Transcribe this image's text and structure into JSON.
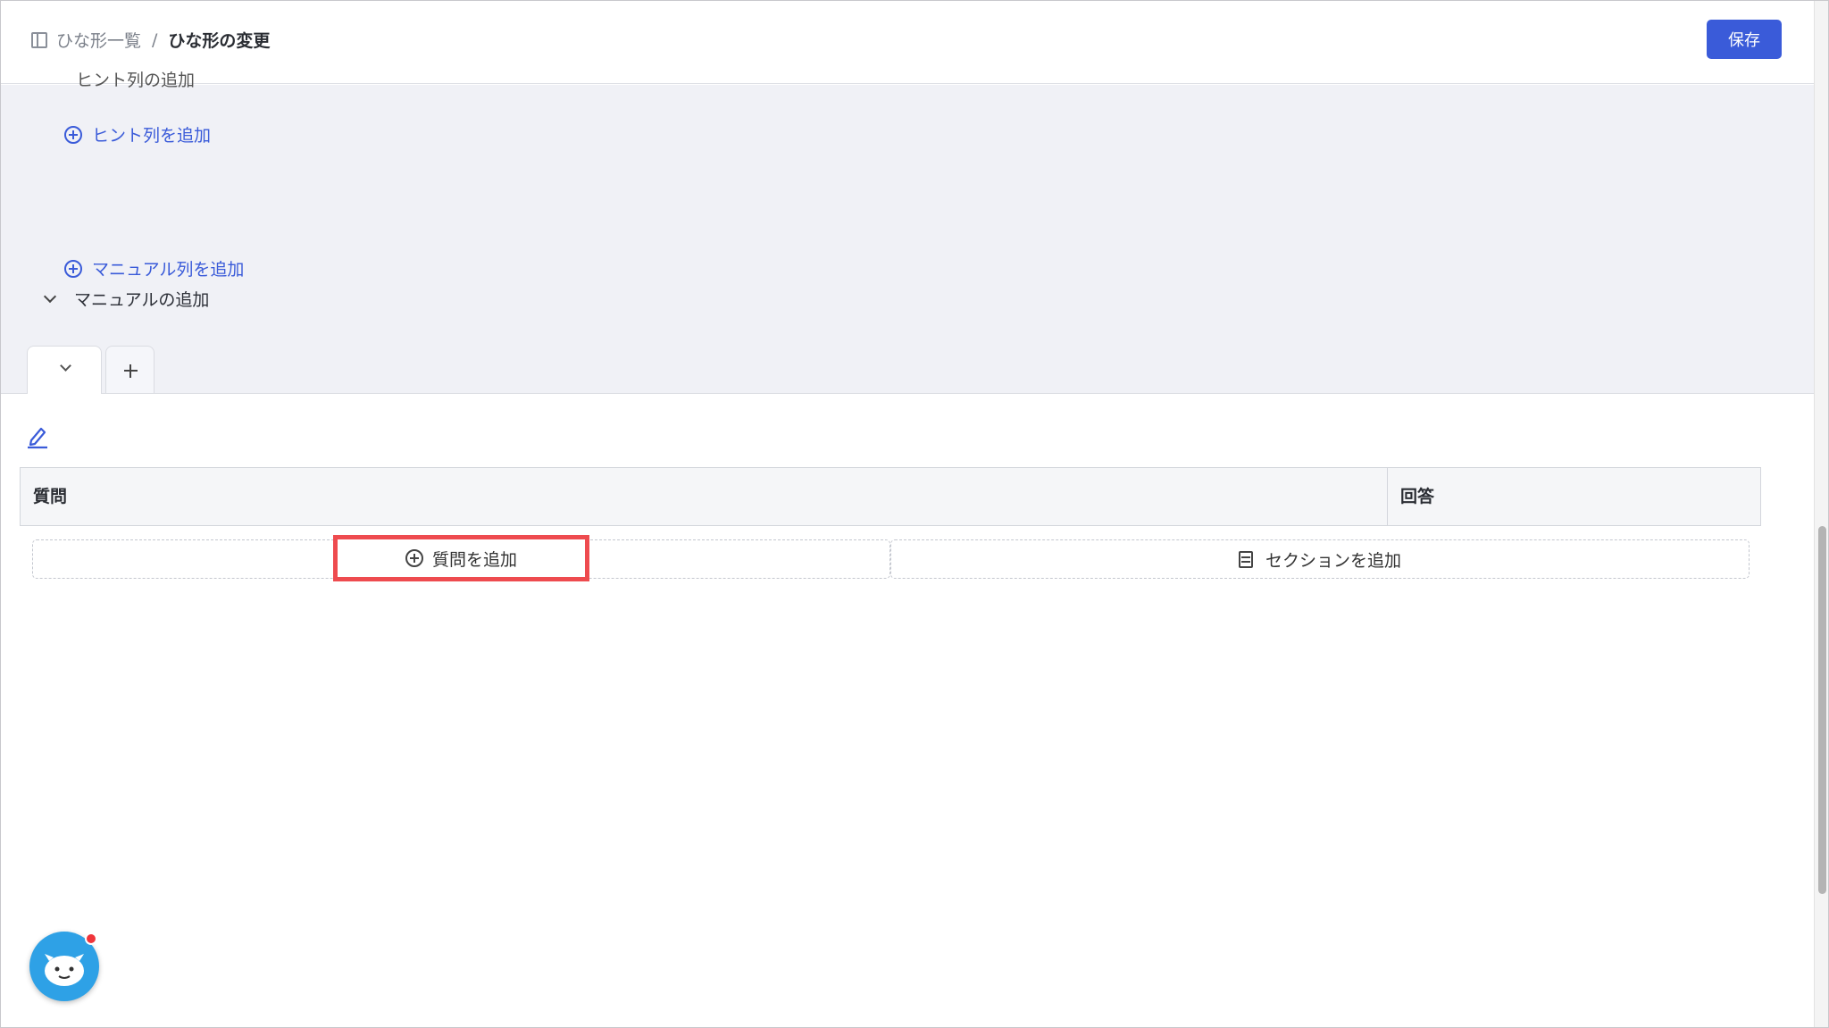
{
  "header": {
    "breadcrumb_parent": "ひな形一覧",
    "breadcrumb_separator": "/",
    "breadcrumb_current": "ひな形の変更",
    "save_label": "保存"
  },
  "settings": {
    "cut_off_heading": "ヒント列の追加",
    "add_hint_label": "ヒント列を追加",
    "manual_section_label": "マニュアルの追加",
    "add_manual_label": "マニュアル列を追加"
  },
  "table": {
    "col_question": "質問",
    "col_answer": "回答",
    "add_question_label": "質問を追加",
    "add_section_label": "セクションを追加"
  },
  "colors": {
    "accent": "#3a5bd9",
    "highlight": "#ee4b4f",
    "settings_bg": "#f0f1f6"
  }
}
